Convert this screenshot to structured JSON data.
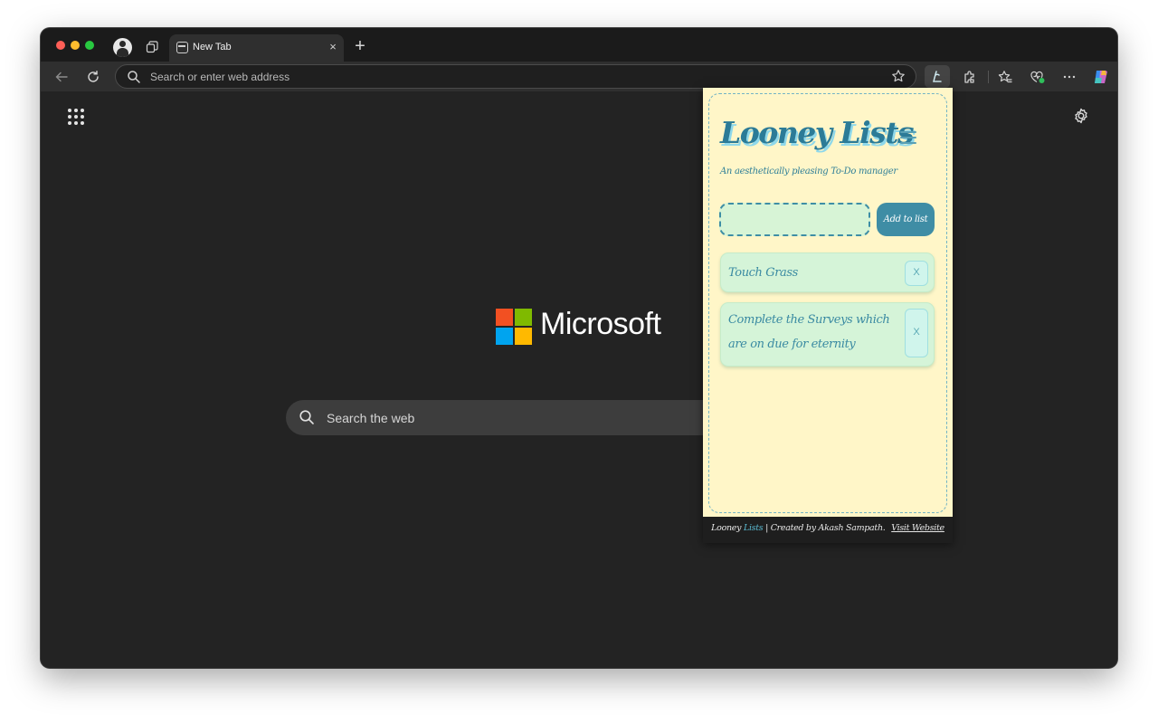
{
  "browser": {
    "tab": {
      "title": "New Tab",
      "close_glyph": "×"
    },
    "new_tab_glyph": "+",
    "address_bar": {
      "placeholder": "Search or enter web address"
    }
  },
  "new_tab_page": {
    "logo_text": "Microsoft",
    "logo_colors": [
      "#f25022",
      "#7fba00",
      "#00a4ef",
      "#ffb900"
    ],
    "search_placeholder": "Search the web"
  },
  "extension_popup": {
    "title": "Looney Lists",
    "subtitle": "An aesthetically pleasing To-Do manager",
    "input_value": "",
    "add_button_label": "Add to list",
    "items": [
      {
        "text": "Touch Grass",
        "delete_label": "X"
      },
      {
        "text": "Complete the Surveys which are on due for eternity",
        "delete_label": "X"
      }
    ],
    "footer": {
      "brand_part1": "Looney",
      "brand_part2": "Lists",
      "credit": " | Created by Akash Sampath.",
      "link_text": "Visit Website"
    },
    "colors": {
      "background": "#fff6c8",
      "accent": "#3f8da5",
      "item_bg": "#d5f4d8"
    }
  }
}
